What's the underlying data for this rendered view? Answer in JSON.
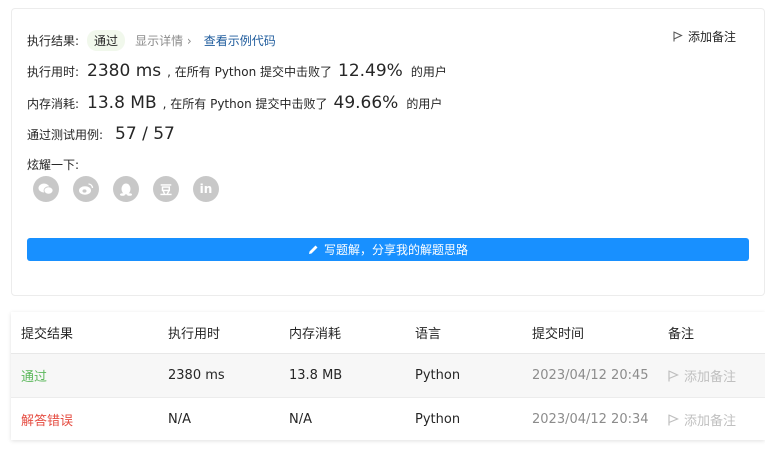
{
  "result": {
    "label": "执行结果:",
    "status": "通过",
    "details_link": "显示详情 ›",
    "example_link": "查看示例代码",
    "add_note": "添加备注"
  },
  "runtime": {
    "label": "执行用时:",
    "value": "2380 ms",
    "middle": ", 在所有 Python 提交中击败了",
    "percent": "12.49%",
    "suffix": "的用户"
  },
  "memory": {
    "label": "内存消耗:",
    "value": "13.8 MB",
    "middle": ", 在所有 Python 提交中击败了",
    "percent": "49.66%",
    "suffix": "的用户"
  },
  "testcases": {
    "label": "通过测试用例:",
    "value": "57 / 57"
  },
  "share": {
    "label": "炫耀一下:",
    "icons": [
      "wechat-icon",
      "weibo-icon",
      "qq-icon",
      "douban-icon",
      "linkedin-icon"
    ],
    "douban_glyph": "豆",
    "linkedin_glyph": "in"
  },
  "write_solution": "写题解，分享我的解题思路",
  "submissions": {
    "headers": [
      "提交结果",
      "执行用时",
      "内存消耗",
      "语言",
      "提交时间",
      "备注"
    ],
    "rows": [
      {
        "status": "通过",
        "runtime": "2380 ms",
        "memory": "13.8 MB",
        "language": "Python",
        "time": "2023/04/12 20:45",
        "note": "添加备注"
      },
      {
        "status": "解答错误",
        "runtime": "N/A",
        "memory": "N/A",
        "language": "Python",
        "time": "2023/04/12 20:34",
        "note": "添加备注"
      }
    ]
  },
  "colors": {
    "accent": "#1890ff",
    "pass": "#5cb85c",
    "fail": "#e54d42"
  }
}
